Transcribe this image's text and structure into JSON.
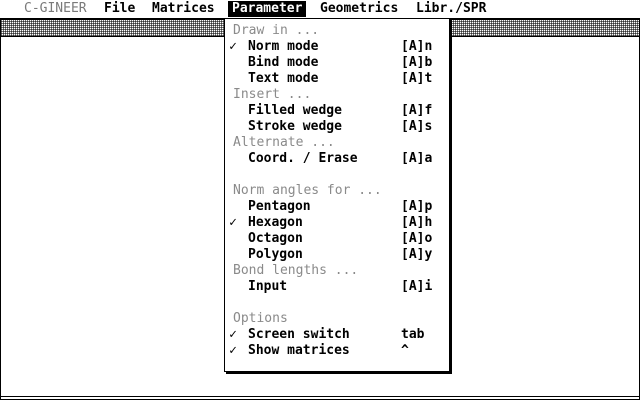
{
  "menubar": {
    "app": "C-GINEER",
    "file": "File",
    "matrices": "Matrices",
    "parameter": "Parameter",
    "geometrics": "Geometrics",
    "libr": "Libr./SPR"
  },
  "dropdown": {
    "draw_in_header": "Draw in ...",
    "norm_mode": {
      "label": "Norm mode",
      "key": "[A]n",
      "check": "✓"
    },
    "bind_mode": {
      "label": "Bind mode",
      "key": "[A]b",
      "check": ""
    },
    "text_mode": {
      "label": "Text mode",
      "key": "[A]t",
      "check": ""
    },
    "insert_header": "Insert ...",
    "filled_wedge": {
      "label": "Filled wedge",
      "key": "[A]f",
      "check": ""
    },
    "stroke_wedge": {
      "label": "Stroke wedge",
      "key": "[A]s",
      "check": ""
    },
    "alternate_header": "Alternate ...",
    "coord_erase": {
      "label": "Coord. / Erase",
      "key": "[A]a",
      "check": ""
    },
    "norm_angles_header": "Norm angles for ...",
    "pentagon": {
      "label": "Pentagon",
      "key": "[A]p",
      "check": ""
    },
    "hexagon": {
      "label": "Hexagon",
      "key": "[A]h",
      "check": "✓"
    },
    "octagon": {
      "label": "Octagon",
      "key": "[A]o",
      "check": ""
    },
    "polygon": {
      "label": "Polygon",
      "key": "[A]y",
      "check": ""
    },
    "bond_lengths_header": "Bond lengths ...",
    "input": {
      "label": "Input",
      "key": "[A]i",
      "check": ""
    },
    "options_header": "Options",
    "screen_switch": {
      "label": "Screen switch",
      "key": "tab",
      "check": "✓"
    },
    "show_matrices": {
      "label": "Show matrices",
      "key": "^",
      "check": "✓"
    }
  }
}
